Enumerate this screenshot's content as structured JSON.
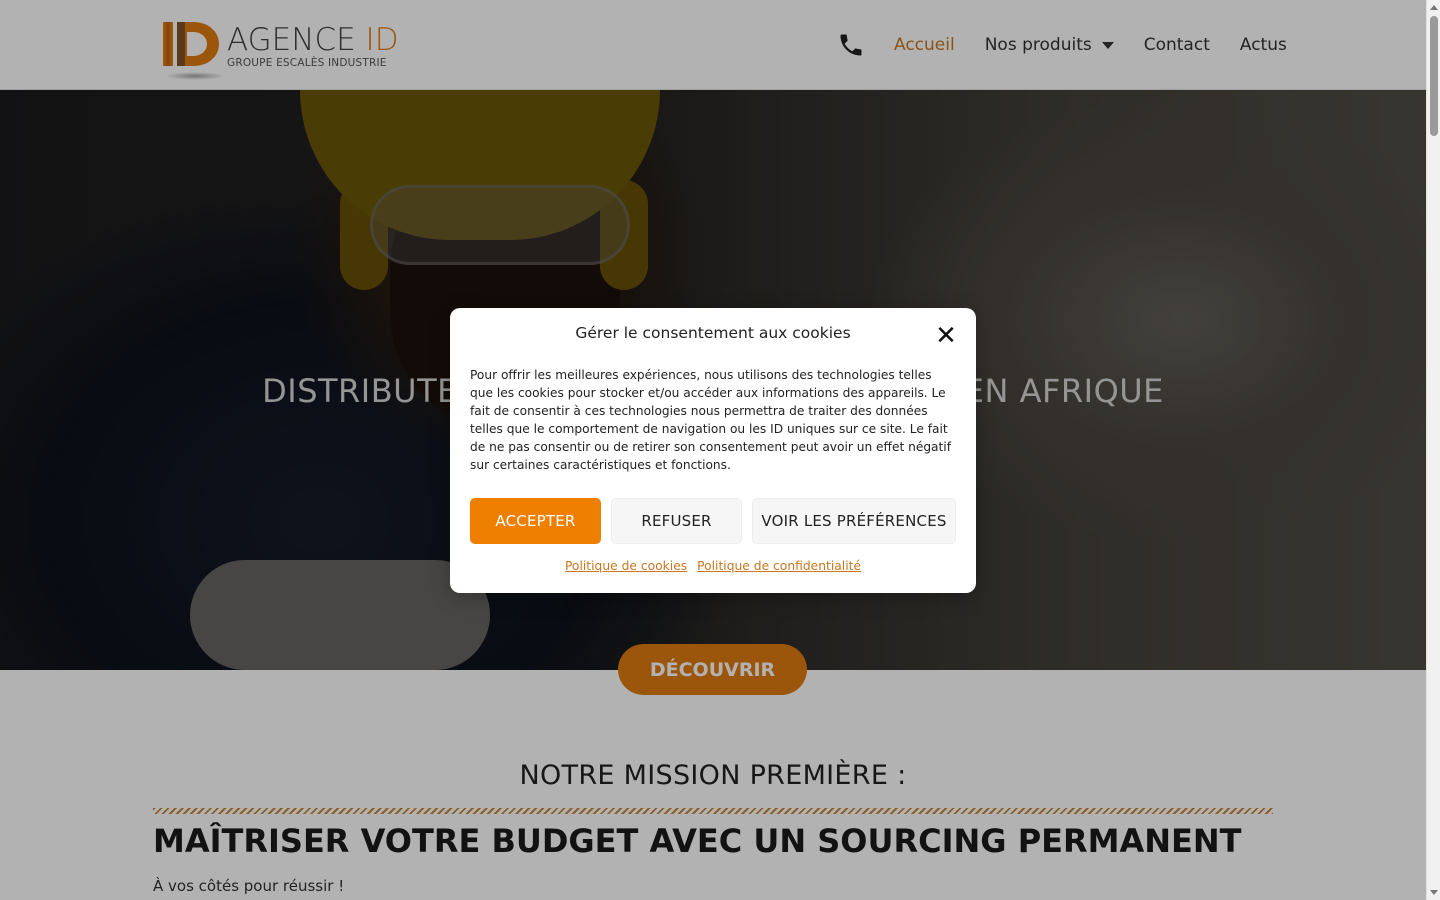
{
  "header": {
    "logo_letters": "ID",
    "logo_name": "AGENCE",
    "logo_name_id": " ID",
    "logo_tagline": "GROUPE ESCALÈS INDUSTRIE",
    "nav": [
      {
        "label": "Accueil",
        "active": true
      },
      {
        "label": "Nos produits",
        "has_dropdown": true
      },
      {
        "label": "Contact"
      },
      {
        "label": "Actus"
      }
    ]
  },
  "hero": {
    "title": "DISTRIBUTEUR DE PIÈCES INDUSTRIELLES EN AFRIQUE",
    "cta_label": "DÉCOUVRIR"
  },
  "section": {
    "mission_title": "NOTRE MISSION PREMIÈRE :",
    "headline": "MAÎTRISER VOTRE BUDGET AVEC UN SOURCING PERMANENT",
    "subline": "À vos côtés pour réussir !"
  },
  "cookie_modal": {
    "title": "Gérer le consentement aux cookies",
    "close_symbol": "✕",
    "body": "Pour offrir les meilleures expériences, nous utilisons des technologies telles que les cookies pour stocker et/ou accéder aux informations des appareils. Le fait de consentir à ces technologies nous permettra de traiter des données telles que le comportement de navigation ou les ID uniques sur ce site. Le fait de ne pas consentir ou de retirer son consentement peut avoir un effet négatif sur certaines caractéristiques et fonctions.",
    "accept_label": "ACCEPTER",
    "refuse_label": "REFUSER",
    "prefs_label": "VOIR LES PRÉFÉRENCES",
    "cookie_policy_link": "Politique de cookies",
    "privacy_policy_link": "Politique de confidentialité"
  },
  "colors": {
    "accent": "#ef7f00",
    "nav_active": "#c8771f"
  },
  "icons": {
    "phone": "phone-icon",
    "close": "close-icon",
    "dropdown": "chevron-down-icon"
  }
}
